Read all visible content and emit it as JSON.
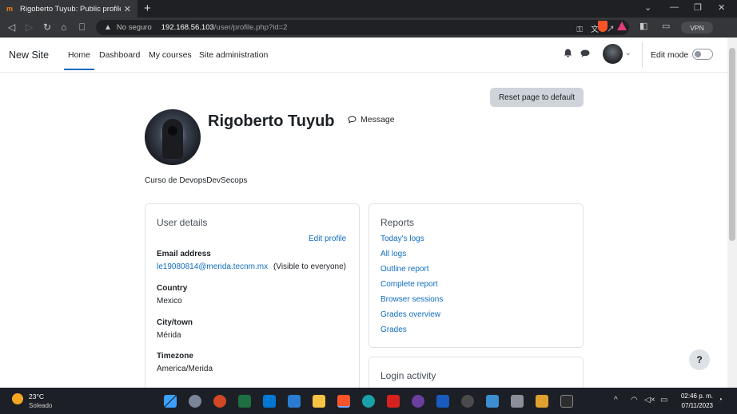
{
  "browser": {
    "tab_title": "Rigoberto Tuyub: Public profile | ...",
    "new_tab": "+",
    "security_label": "No seguro",
    "url_host": "192.168.56.103",
    "url_path": "/user/profile.php?id=2",
    "vpn_label": "VPN"
  },
  "navbar": {
    "brand": "New Site",
    "items": [
      "Home",
      "Dashboard",
      "My courses",
      "Site administration"
    ],
    "active": "Home",
    "edit_mode_label": "Edit mode",
    "edit_mode_on": false
  },
  "page": {
    "reset_button": "Reset page to default",
    "user_name": "Rigoberto Tuyub",
    "message_label": "Message",
    "description": "Curso de DevopsDevSecops",
    "help_label": "?"
  },
  "user_details": {
    "title": "User details",
    "edit_link": "Edit profile",
    "email_label": "Email address",
    "email_value": "le19080814@merida.tecnm.mx",
    "email_visibility": "(Visible to everyone)",
    "country_label": "Country",
    "country_value": "Mexico",
    "city_label": "City/town",
    "city_value": "Mérida",
    "timezone_label": "Timezone",
    "timezone_value": "America/Merida"
  },
  "reports": {
    "title": "Reports",
    "links": [
      "Today's logs",
      "All logs",
      "Outline report",
      "Complete report",
      "Browser sessions",
      "Grades overview",
      "Grades"
    ]
  },
  "login_activity": {
    "title": "Login activity"
  },
  "taskbar": {
    "temperature": "23°C",
    "condition": "Soleado",
    "time": "02:46 p. m.",
    "date": "07/11/2023"
  },
  "colors": {
    "link": "#0f6cbf",
    "active_underline": "#0f6cbf",
    "reset_bg": "#ced4da"
  }
}
